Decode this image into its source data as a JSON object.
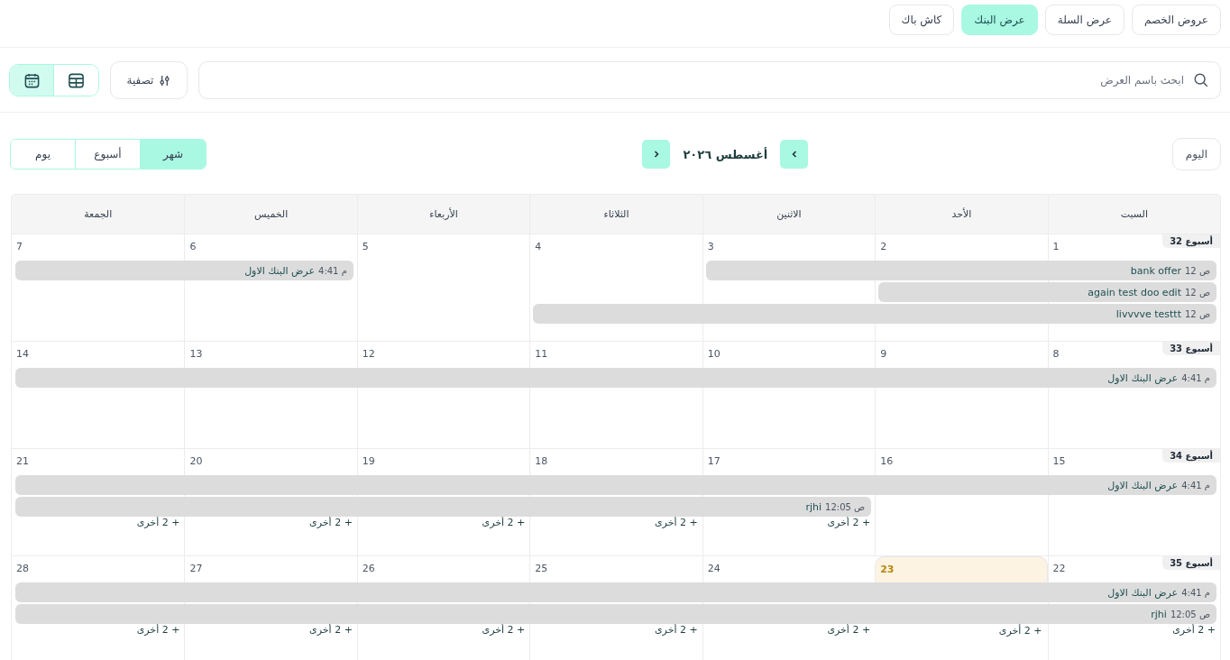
{
  "tabs": [
    {
      "label": "عروض الخصم",
      "selected": false
    },
    {
      "label": "عرض السلة",
      "selected": false
    },
    {
      "label": "عرض البنك",
      "selected": true
    },
    {
      "label": "كاش باك",
      "selected": false
    }
  ],
  "search": {
    "placeholder": "ابحث باسم العرض"
  },
  "filter_button": "تصفية",
  "view_toggle": [
    {
      "kind": "table",
      "selected": false
    },
    {
      "kind": "calendar",
      "selected": true
    }
  ],
  "today_button": "اليوم",
  "month_title": "أغسطس ٢٠٢٦",
  "view_modes": [
    {
      "label": "شهر",
      "selected": true
    },
    {
      "label": "أسبوع",
      "selected": false
    },
    {
      "label": "يوم",
      "selected": false
    }
  ],
  "weekdays": [
    "السبت",
    "الأحد",
    "الاثنين",
    "الثلاثاء",
    "الأربعاء",
    "الخميس",
    "الجمعة"
  ],
  "weeks": [
    {
      "label": "أسبوع 32",
      "days": [
        {
          "date": "1",
          "today": false
        },
        {
          "date": "2",
          "today": false
        },
        {
          "date": "3",
          "today": false
        },
        {
          "date": "4",
          "today": false
        },
        {
          "date": "5",
          "today": false
        },
        {
          "date": "6",
          "today": false
        },
        {
          "date": "7",
          "today": false
        }
      ],
      "lanes": [
        [
          {
            "kind": "start",
            "time": "ص 12",
            "title": "bank offer"
          },
          {
            "kind": "continue"
          },
          {
            "kind": "continue"
          },
          {
            "kind": "empty"
          },
          {
            "kind": "empty"
          },
          {
            "kind": "start",
            "time": "م 4:41",
            "title": "عرض البنك الاول"
          },
          {
            "kind": "continue"
          }
        ],
        [
          {
            "kind": "start",
            "time": "ص 12",
            "title": "again test doo edit"
          },
          {
            "kind": "continue"
          }
        ],
        [
          {
            "kind": "start",
            "time": "ص 12",
            "title": "livvvve testtt"
          },
          {
            "kind": "continue"
          },
          {
            "kind": "continue"
          },
          {
            "kind": "continue"
          }
        ]
      ]
    },
    {
      "label": "أسبوع 33",
      "days": [
        {
          "date": "8",
          "today": false
        },
        {
          "date": "9",
          "today": false
        },
        {
          "date": "10",
          "today": false
        },
        {
          "date": "11",
          "today": false
        },
        {
          "date": "12",
          "today": false
        },
        {
          "date": "13",
          "today": false
        },
        {
          "date": "14",
          "today": false
        }
      ],
      "lanes": [
        [
          {
            "kind": "start",
            "time": "م 4:41",
            "title": "عرض البنك الاول"
          },
          {
            "kind": "continue"
          },
          {
            "kind": "continue"
          },
          {
            "kind": "continue"
          },
          {
            "kind": "continue"
          },
          {
            "kind": "continue"
          },
          {
            "kind": "continue"
          }
        ]
      ]
    },
    {
      "label": "أسبوع 34",
      "days": [
        {
          "date": "15",
          "today": false
        },
        {
          "date": "16",
          "today": false
        },
        {
          "date": "17",
          "today": false,
          "more": "+ 2 أخرى"
        },
        {
          "date": "18",
          "today": false,
          "more": "+ 2 أخرى"
        },
        {
          "date": "19",
          "today": false,
          "more": "+ 2 أخرى"
        },
        {
          "date": "20",
          "today": false,
          "more": "+ 2 أخرى"
        },
        {
          "date": "21",
          "today": false,
          "more": "+ 2 أخرى"
        }
      ],
      "lanes": [
        [
          {
            "kind": "start",
            "time": "م 4:41",
            "title": "عرض البنك الاول"
          },
          {
            "kind": "continue"
          },
          {
            "kind": "continue"
          },
          {
            "kind": "continue"
          },
          {
            "kind": "continue"
          },
          {
            "kind": "continue"
          },
          {
            "kind": "continue"
          }
        ],
        [
          {
            "kind": "empty"
          },
          {
            "kind": "empty"
          },
          {
            "kind": "start",
            "time": "ص 12:05",
            "title": "rjhi"
          },
          {
            "kind": "continue"
          },
          {
            "kind": "continue"
          },
          {
            "kind": "continue"
          },
          {
            "kind": "continue"
          }
        ]
      ]
    },
    {
      "label": "أسبوع 35",
      "days": [
        {
          "date": "22",
          "today": false,
          "more": "+ 2 أخرى"
        },
        {
          "date": "23",
          "today": true,
          "more": "+ 2 أخرى"
        },
        {
          "date": "24",
          "today": false,
          "more": "+ 2 أخرى"
        },
        {
          "date": "25",
          "today": false,
          "more": "+ 2 أخرى"
        },
        {
          "date": "26",
          "today": false,
          "more": "+ 2 أخرى"
        },
        {
          "date": "27",
          "today": false,
          "more": "+ 2 أخرى"
        },
        {
          "date": "28",
          "today": false,
          "more": "+ 2 أخرى"
        }
      ],
      "lanes": [
        [
          {
            "kind": "start",
            "time": "م 4:41",
            "title": "عرض البنك الاول"
          },
          {
            "kind": "continue"
          },
          {
            "kind": "continue"
          },
          {
            "kind": "continue"
          },
          {
            "kind": "continue"
          },
          {
            "kind": "continue"
          },
          {
            "kind": "continue"
          }
        ],
        [
          {
            "kind": "start",
            "time": "ص 12:05",
            "title": "rjhi"
          },
          {
            "kind": "continue"
          },
          {
            "kind": "continue"
          },
          {
            "kind": "continue"
          },
          {
            "kind": "continue"
          },
          {
            "kind": "continue"
          },
          {
            "kind": "continue"
          }
        ]
      ]
    }
  ]
}
